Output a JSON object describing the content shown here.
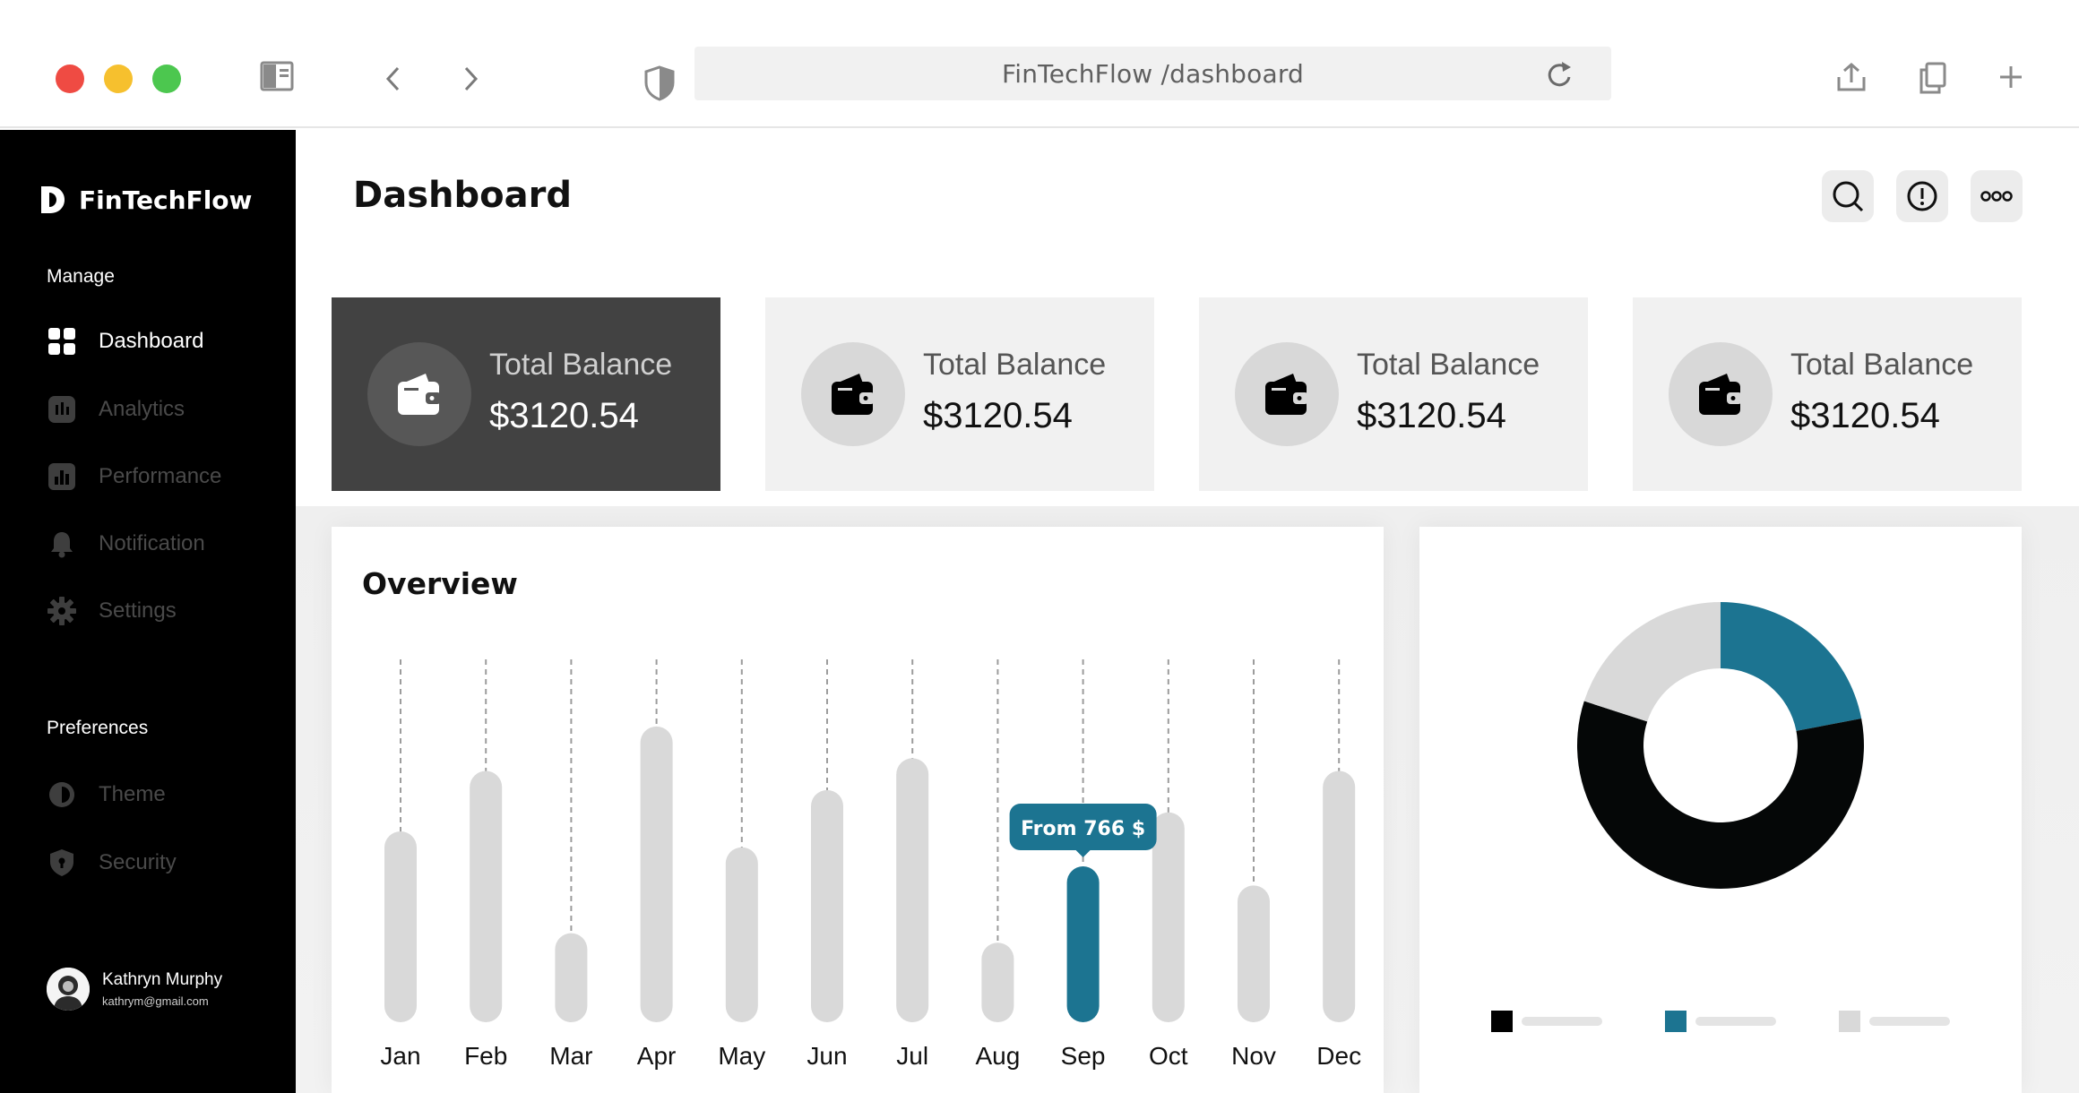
{
  "browser": {
    "url": "FinTechFlow /dashboard",
    "icons": [
      "sidebar-toggle-icon",
      "chevron-left-icon",
      "chevron-right-icon",
      "shield-icon",
      "reload-icon",
      "share-icon",
      "copy-icon",
      "plus-icon"
    ]
  },
  "sidebar": {
    "brand": "FinTechFlow",
    "manage_label": "Manage",
    "items": [
      {
        "label": "Dashboard",
        "icon": "grid-icon",
        "active": true
      },
      {
        "label": "Analytics",
        "icon": "analytics-icon",
        "active": false
      },
      {
        "label": "Performance",
        "icon": "bar-chart-icon",
        "active": false
      },
      {
        "label": "Notification",
        "icon": "bell-icon",
        "active": false
      },
      {
        "label": "Settings",
        "icon": "gear-icon",
        "active": false
      }
    ],
    "preferences_label": "Preferences",
    "pref_items": [
      {
        "label": "Theme",
        "icon": "theme-icon"
      },
      {
        "label": "Security",
        "icon": "shield-icon"
      }
    ],
    "user": {
      "name": "Kathryn Murphy",
      "email": "kathrym@gmail.com"
    }
  },
  "header": {
    "title": "Dashboard",
    "actions": [
      "search-icon",
      "alert-icon",
      "more-icon"
    ]
  },
  "cards": [
    {
      "label": "Total Balance",
      "value": "$3120.54",
      "selected": true
    },
    {
      "label": "Total Balance",
      "value": "$3120.54",
      "selected": false
    },
    {
      "label": "Total Balance",
      "value": "$3120.54",
      "selected": false
    },
    {
      "label": "Total Balance",
      "value": "$3120.54",
      "selected": false
    }
  ],
  "overview": {
    "title": "Overview",
    "tooltip": "From 766 $"
  },
  "colors": {
    "accent": "#1c7491",
    "bar": "#d9d9d9",
    "dark": "#000000",
    "light_gray": "#d9d9d9"
  },
  "chart_data": [
    {
      "type": "bar",
      "categories": [
        "Jan",
        "Feb",
        "Mar",
        "Apr",
        "May",
        "Jun",
        "Jul",
        "Aug",
        "Sep",
        "Oct",
        "Nov",
        "Dec"
      ],
      "values": [
        0.6,
        0.79,
        0.28,
        0.93,
        0.55,
        0.73,
        0.83,
        0.25,
        0.49,
        0.66,
        0.43,
        0.79
      ],
      "highlight_index": 8,
      "ylim": [
        0,
        1
      ]
    },
    {
      "type": "pie",
      "values": [
        22,
        58,
        20
      ],
      "colors": [
        "#1c7491",
        "#050707",
        "#d9d9d9"
      ],
      "legend": [
        "#000000",
        "#1c7491",
        "#d9d9d9"
      ]
    }
  ]
}
